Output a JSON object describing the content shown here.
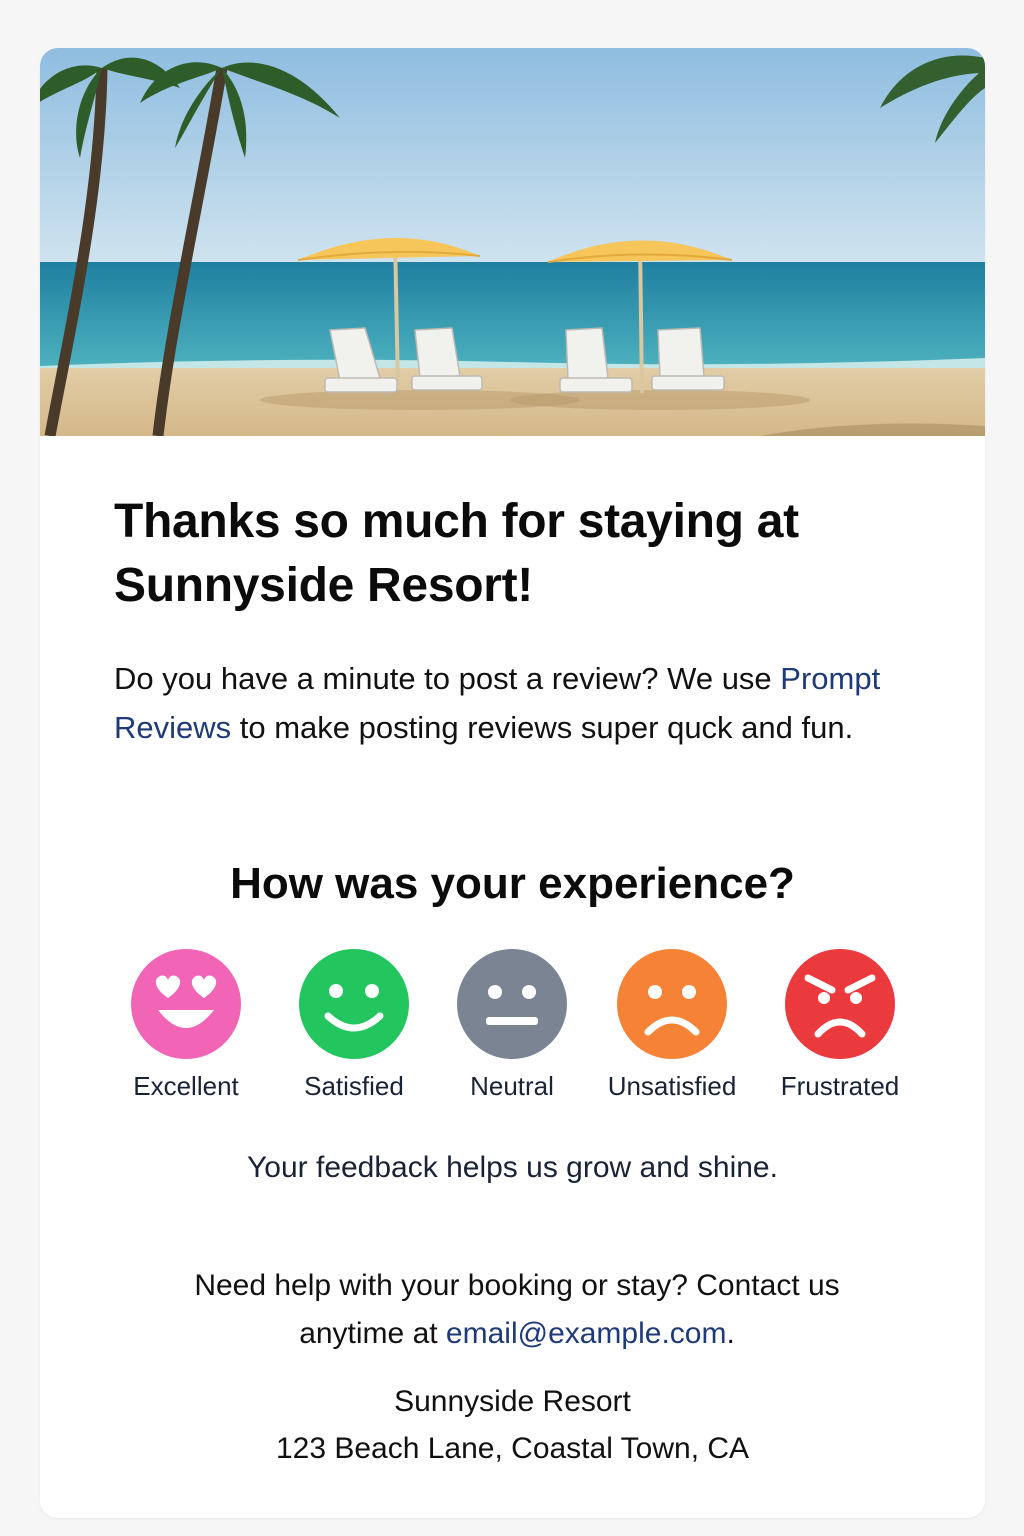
{
  "hero": {
    "image_description": "beach-scene-with-umbrellas-and-chairs"
  },
  "headline": "Thanks so much for staying at Sunnyside Resort!",
  "intro": {
    "text_before": "Do you have a minute to post a review? We use ",
    "link_text": "Prompt Reviews",
    "text_after": " to make posting reviews super quck and fun."
  },
  "question": "How was your experience?",
  "ratings": [
    {
      "label": "Excellent",
      "icon": "heart-eyes-face-icon",
      "color": "#f264b6"
    },
    {
      "label": "Satisfied",
      "icon": "smiling-face-icon",
      "color": "#22c55e"
    },
    {
      "label": "Neutral",
      "icon": "neutral-face-icon",
      "color": "#7b8492"
    },
    {
      "label": "Unsatisfied",
      "icon": "frowning-face-icon",
      "color": "#f58235"
    },
    {
      "label": "Frustrated",
      "icon": "angry-face-icon",
      "color": "#ea3a3e"
    }
  ],
  "tagline": "Your feedback helps us grow and shine.",
  "help": {
    "text_before": "Need help with your booking or stay? Contact us anytime at ",
    "email": "email@example.com",
    "text_after": "."
  },
  "address": {
    "name": "Sunnyside Resort",
    "street": "123 Beach Lane, Coastal Town, CA"
  },
  "colors": {
    "link": "#1f3a78",
    "text": "#111111",
    "background": "#f6f6f7"
  }
}
